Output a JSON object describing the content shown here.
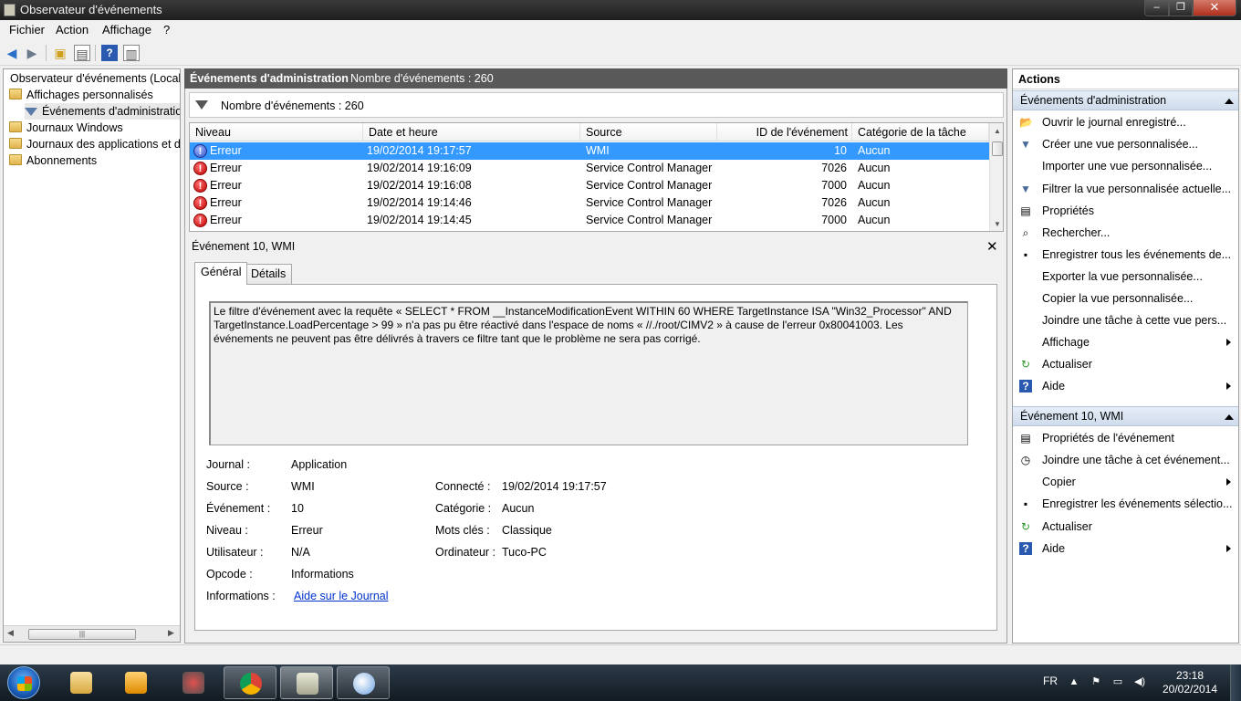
{
  "window": {
    "title": "Observateur d'événements",
    "min": "–",
    "max": "❐",
    "close": "✕"
  },
  "menu": [
    "Fichier",
    "Action",
    "Affichage",
    "?"
  ],
  "tree": {
    "items": [
      {
        "label": "Observateur d'événements (Local)"
      },
      {
        "label": "Affichages personnalisés"
      },
      {
        "label": "Événements d'administration"
      },
      {
        "label": "Journaux Windows"
      },
      {
        "label": "Journaux des applications et de"
      },
      {
        "label": "Abonnements"
      }
    ]
  },
  "center": {
    "header_title": "Événements d'administration",
    "header_count": "Nombre d'événements : 260",
    "filter_text": "Nombre d'événements : 260",
    "columns": [
      "Niveau",
      "Date et heure",
      "Source",
      "ID de l'événement",
      "Catégorie de la tâche"
    ],
    "rows": [
      {
        "level": "Erreur",
        "date": "19/02/2014 19:17:57",
        "source": "WMI",
        "id": "10",
        "category": "Aucun",
        "selected": true
      },
      {
        "level": "Erreur",
        "date": "19/02/2014 19:16:09",
        "source": "Service Control Manager",
        "id": "7026",
        "category": "Aucun"
      },
      {
        "level": "Erreur",
        "date": "19/02/2014 19:16:08",
        "source": "Service Control Manager",
        "id": "7000",
        "category": "Aucun"
      },
      {
        "level": "Erreur",
        "date": "19/02/2014 19:14:46",
        "source": "Service Control Manager",
        "id": "7026",
        "category": "Aucun"
      },
      {
        "level": "Erreur",
        "date": "19/02/2014 19:14:45",
        "source": "Service Control Manager",
        "id": "7000",
        "category": "Aucun"
      }
    ]
  },
  "detail": {
    "title": "Événement 10, WMI",
    "tabs": [
      "Général",
      "Détails"
    ],
    "message": "Le filtre d'événement avec la requête « SELECT * FROM __InstanceModificationEvent WITHIN 60 WHERE TargetInstance ISA \"Win32_Processor\" AND TargetInstance.LoadPercentage > 99 » n'a pas pu être réactivé dans l'espace de noms « //./root/CIMV2 » à cause de l'erreur 0x80041003. Les événements ne peuvent pas être délivrés à travers ce filtre tant que le problème ne sera pas corrigé.",
    "fields": {
      "journal_label": "Journal :",
      "journal": "Application",
      "source_label": "Source :",
      "source": "WMI",
      "connecte_label": "Connecté :",
      "connecte": "19/02/2014 19:17:57",
      "evenement_label": "Événement :",
      "evenement": "10",
      "categorie_label": "Catégorie :",
      "categorie": "Aucun",
      "niveau_label": "Niveau :",
      "niveau": "Erreur",
      "motscles_label": "Mots clés :",
      "motscles": "Classique",
      "utilisateur_label": "Utilisateur :",
      "utilisateur": "N/A",
      "ordinateur_label": "Ordinateur :",
      "ordinateur": "Tuco-PC",
      "opcode_label": "Opcode :",
      "opcode": "Informations",
      "informations_label": "Informations :",
      "informations_link": "Aide sur le Journal"
    }
  },
  "actions": {
    "header": "Actions",
    "section1": "Événements d'administration",
    "items1": [
      "Ouvrir le journal enregistré...",
      "Créer une vue personnalisée...",
      "Importer une vue personnalisée...",
      "Filtrer la vue personnalisée actuelle...",
      "Propriétés",
      "Rechercher...",
      "Enregistrer tous les événements de...",
      "Exporter la vue personnalisée...",
      "Copier la vue personnalisée...",
      "Joindre une tâche à cette vue pers...",
      "Affichage",
      "Actualiser",
      "Aide"
    ],
    "section2": "Événement 10, WMI",
    "items2": [
      "Propriétés de l'événement",
      "Joindre une tâche à cet événement...",
      "Copier",
      "Enregistrer les événements sélectio...",
      "Actualiser",
      "Aide"
    ]
  },
  "taskbar": {
    "lang": "FR",
    "time": "23:18",
    "date": "20/02/2014"
  },
  "colors": {
    "selection": "#3399ff",
    "error": "#c00000",
    "link": "#0033cc"
  }
}
